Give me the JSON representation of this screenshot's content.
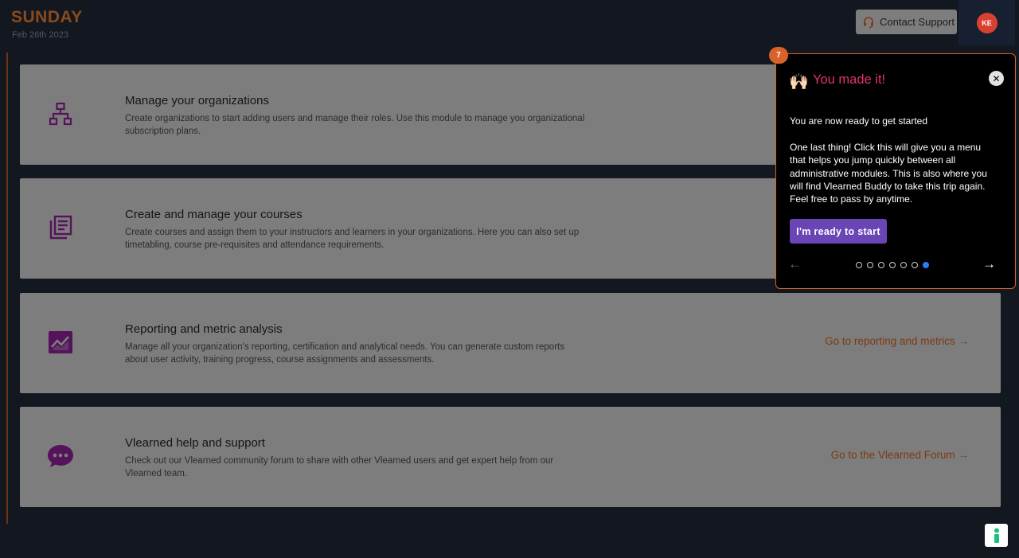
{
  "header": {
    "day": "SUNDAY",
    "date": "Feb 26th 2023",
    "support_label": "Contact Support",
    "avatar_initials": "KE"
  },
  "cards": [
    {
      "title": "Manage your organizations",
      "description": "Create organizations to start adding users and manage their roles. Use this module to manage you organizational subscription plans.",
      "icon": "sitemap-icon",
      "link": ""
    },
    {
      "title": "Create and manage your courses",
      "description": "Create courses and assign them to your instructors and learners in your organizations. Here you can also set up timetabling, course pre-requisites and attendance requirements.",
      "icon": "courses-icon",
      "link": ""
    },
    {
      "title": "Reporting and metric analysis",
      "description": "Manage all your organization's reporting, certification and analytical needs. You can generate custom reports about user activity, training progress, course assignments and assessments.",
      "icon": "chart-icon",
      "link": "Go to reporting and metrics →"
    },
    {
      "title": "Vlearned help and support",
      "description": "Check out our Vlearned community forum to share with other Vlearned users and get expert help from our Vlearned team.",
      "icon": "chat-icon",
      "link": "Go to the Vlearned Forum →"
    }
  ],
  "tour": {
    "step": "7",
    "emoji": "🙌🏻",
    "title": "You made it!",
    "text1": "You are now ready to get started",
    "text2": "One last thing! Click this will give you a menu that helps you jump quickly between all administrative modules. This is also where you will find Vlearned Buddy to take this trip again. Feel free to pass by anytime.",
    "cta": "I'm ready to start",
    "total_steps": 7,
    "current_step": 7,
    "prev": "←",
    "next": "→",
    "close": "✕"
  },
  "colors": {
    "accent": "#d9622a",
    "title_pink": "#e0336c",
    "cta_purple": "#6a45b6",
    "icon_purple": "#54135a",
    "link_orange": "#7d3a14"
  }
}
